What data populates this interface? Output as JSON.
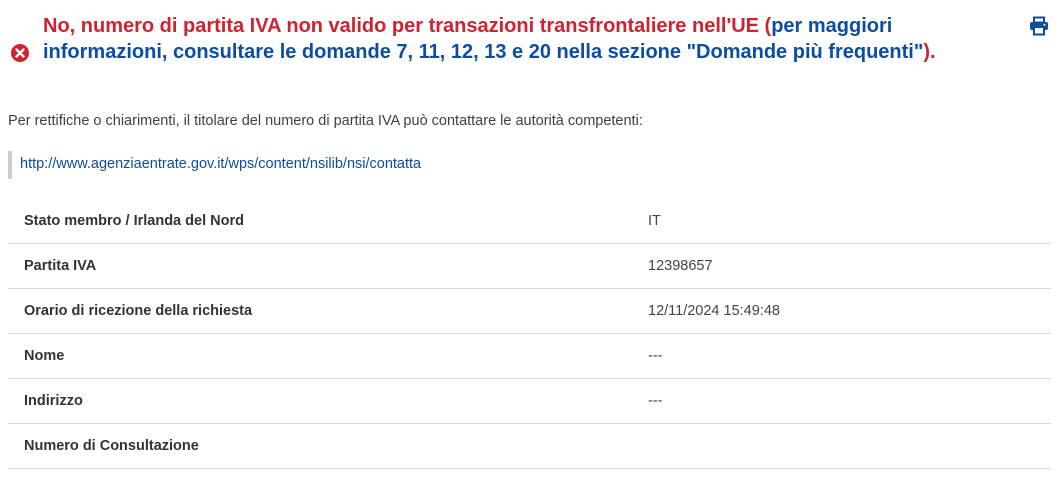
{
  "status": {
    "part1": "No, numero di partita IVA non valido per transazioni transfrontaliere nell'UE",
    "paren_open": " (",
    "info": "per maggiori informazioni, consultare le domande 7, 11, 12, 13 e 20 nella sezione \"Domande più frequenti\"",
    "paren_close": ").",
    "icon": "error-circle-x-icon",
    "color_error": "#d0222f",
    "color_info": "#0c4da2"
  },
  "print_icon": "print-icon",
  "note": "Per rettifiche o chiarimenti, il titolare del numero di partita IVA può contattare le autorità competenti:",
  "contact_link": "http://www.agenziaentrate.gov.it/wps/content/nsilib/nsi/contatta",
  "details": [
    {
      "label": "Stato membro / Irlanda del Nord",
      "value": "IT"
    },
    {
      "label": "Partita IVA",
      "value": "12398657"
    },
    {
      "label": "Orario di ricezione della richiesta",
      "value": "12/11/2024 15:49:48"
    },
    {
      "label": "Nome",
      "value": "---"
    },
    {
      "label": "Indirizzo",
      "value": "---"
    },
    {
      "label": "Numero di Consultazione",
      "value": ""
    }
  ]
}
